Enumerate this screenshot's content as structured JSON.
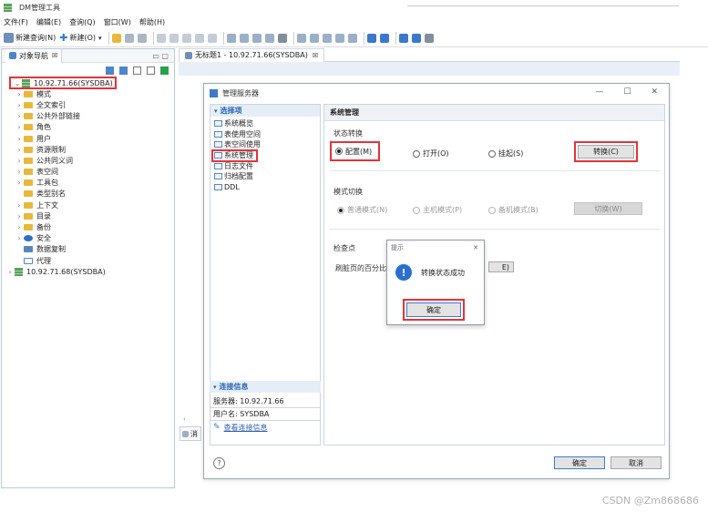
{
  "window": {
    "title": "DM管理工具"
  },
  "menu": [
    "文件(F)",
    "编辑(E)",
    "查询(Q)",
    "窗口(W)",
    "帮助(H)"
  ],
  "toolbar": {
    "new_query": "新建查询(N)",
    "new": "新建(O)"
  },
  "object_nav": {
    "tab_label": "对象导航",
    "tab_close": "☒",
    "connections": [
      {
        "label": "10.92.71.66(SYSDBA)",
        "expanded": true,
        "children": [
          "模式",
          "全文索引",
          "公共外部链接",
          "角色",
          "用户",
          "资源限制",
          "公共同义词",
          "表空间",
          "工具包",
          "类型别名",
          "上下文",
          "目录",
          "备份",
          "安全",
          "数据复制",
          "代理"
        ]
      },
      {
        "label": "10.92.71.68(SYSDBA)",
        "expanded": false
      }
    ]
  },
  "editor": {
    "tab_label": "无标题1 - 10.92.71.66(SYSDBA)",
    "tab_close": "☒",
    "bottom_tab": "消"
  },
  "dialog": {
    "title": "管理服务器",
    "win_controls": {
      "minimize": "—",
      "maximize": "☐",
      "close": "✕"
    },
    "nav_header": "选择项",
    "nav_items": [
      "系统概览",
      "表使用空间",
      "表空间使用",
      "系统管理",
      "日志文件",
      "归档配置",
      "DDL"
    ],
    "selected_nav": "系统管理",
    "section_title": "系统管理",
    "state_switch": {
      "label": "状态转换",
      "options": [
        "配置(M)",
        "打开(O)",
        "挂起(S)"
      ],
      "selected": "配置(M)",
      "button": "转换(C)"
    },
    "mode_switch": {
      "label": "模式切换",
      "options": [
        "普通模式(N)",
        "主机模式(P)",
        "备机模式(B)"
      ],
      "selected": "普通模式(N)",
      "button": "切换(W)"
    },
    "checkpoint": {
      "label": "检查点",
      "field_label": "刷脏页的百分比",
      "button_suffix": "E)"
    },
    "connection_info": {
      "header": "连接信息",
      "server": "服务器: 10.92.71.66",
      "user": "用户名: SYSDBA",
      "link": "查看连接信息"
    },
    "help": "?",
    "ok": "确定",
    "cancel": "取消"
  },
  "popup": {
    "title": "提示",
    "close": "✕",
    "icon": "info-icon",
    "message": "转换状态成功",
    "ok": "确定"
  },
  "watermark": "CSDN @Zm868686",
  "colors": {
    "accent": "#2a6fcf",
    "highlight": "#e2333a",
    "folder": "#e7b83c"
  }
}
